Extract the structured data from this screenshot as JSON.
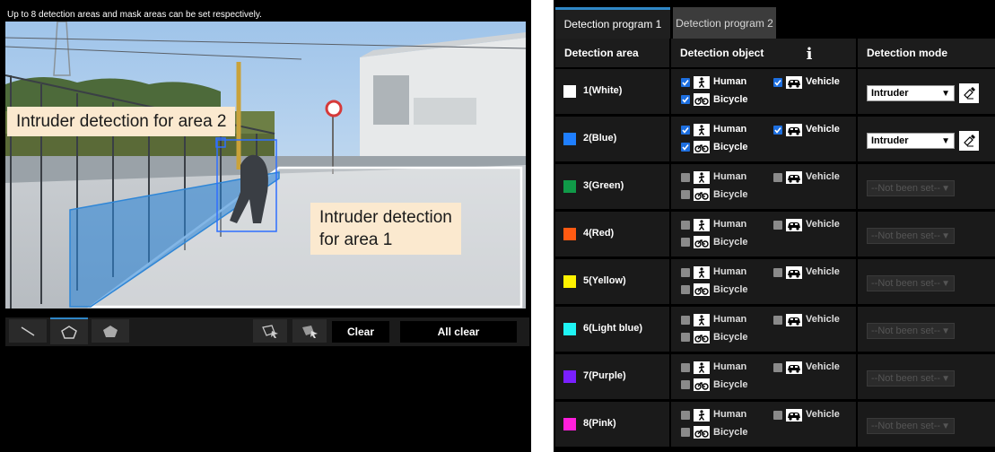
{
  "hint": "Up to 8 detection areas and mask areas can be set respectively.",
  "callouts": {
    "area2": "Intruder detection for area 2",
    "area1_line1": "Intruder detection",
    "area1_line2": "for area 1"
  },
  "toolbar": {
    "clear_label": "Clear",
    "all_clear_label": "All clear"
  },
  "tabs": [
    {
      "label": "Detection program 1",
      "active": true
    },
    {
      "label": "Detection program 2",
      "active": false
    }
  ],
  "table": {
    "headers": {
      "area": "Detection area",
      "object": "Detection object",
      "info_icon": "i",
      "mode": "Detection mode"
    },
    "object_labels": {
      "human": "Human",
      "vehicle": "Vehicle",
      "bicycle": "Bicycle"
    },
    "rows": [
      {
        "area": "1(White)",
        "color": "#ffffff",
        "enabled": true,
        "mode": "Intruder"
      },
      {
        "area": "2(Blue)",
        "color": "#1f7fff",
        "enabled": true,
        "mode": "Intruder"
      },
      {
        "area": "3(Green)",
        "color": "#109a48",
        "enabled": false,
        "mode": "--Not been set--"
      },
      {
        "area": "4(Red)",
        "color": "#ff5a12",
        "enabled": false,
        "mode": "--Not been set--"
      },
      {
        "area": "5(Yellow)",
        "color": "#fff200",
        "enabled": false,
        "mode": "--Not been set--"
      },
      {
        "area": "6(Light blue)",
        "color": "#1ff4f4",
        "enabled": false,
        "mode": "--Not been set--"
      },
      {
        "area": "7(Purple)",
        "color": "#7a1fff",
        "enabled": false,
        "mode": "--Not been set--"
      },
      {
        "area": "8(Pink)",
        "color": "#ff1fdc",
        "enabled": false,
        "mode": "--Not been set--"
      }
    ]
  },
  "colors": {
    "accent": "#2f86c6",
    "checked": "#1d6fe0",
    "unchecked": "#8a8a8a"
  }
}
